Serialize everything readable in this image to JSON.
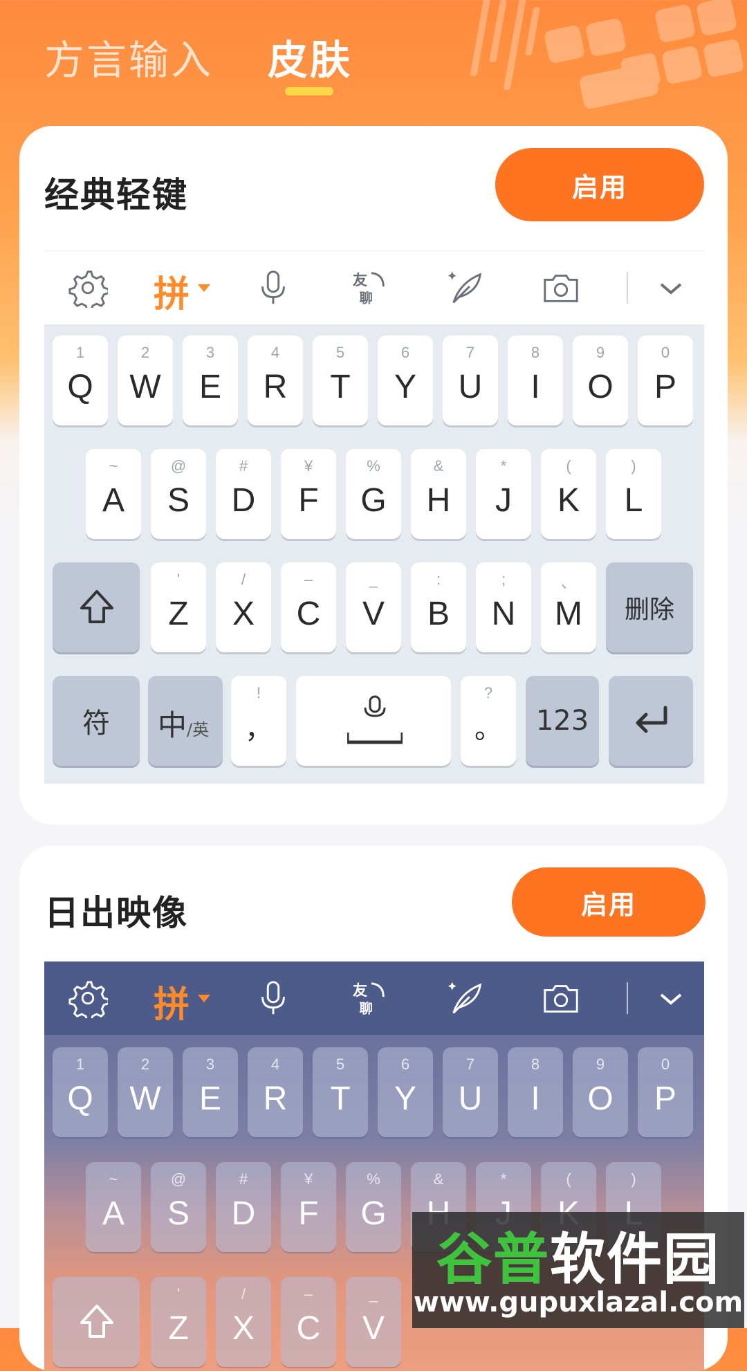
{
  "tabs": [
    {
      "label": "方言输入",
      "active": false
    },
    {
      "label": "皮肤",
      "active": true
    }
  ],
  "skins": [
    {
      "title": "经典轻键",
      "action_label": "启用"
    },
    {
      "title": "日出映像",
      "action_label": "启用"
    }
  ],
  "toolbar": {
    "icons": [
      "gear-icon",
      "pinyin-mode",
      "microphone-icon",
      "youliao-icon",
      "handwriting-quill-icon",
      "camera-icon",
      "chevron-down-icon"
    ],
    "pinyin_label": "拼"
  },
  "keyboard": {
    "row1": [
      {
        "main": "Q",
        "sub": "1"
      },
      {
        "main": "W",
        "sub": "2"
      },
      {
        "main": "E",
        "sub": "3"
      },
      {
        "main": "R",
        "sub": "4"
      },
      {
        "main": "T",
        "sub": "5"
      },
      {
        "main": "Y",
        "sub": "6"
      },
      {
        "main": "U",
        "sub": "7"
      },
      {
        "main": "I",
        "sub": "8"
      },
      {
        "main": "O",
        "sub": "9"
      },
      {
        "main": "P",
        "sub": "0"
      }
    ],
    "row2": [
      {
        "main": "A",
        "sub": "~"
      },
      {
        "main": "S",
        "sub": "@"
      },
      {
        "main": "D",
        "sub": "#"
      },
      {
        "main": "F",
        "sub": "¥"
      },
      {
        "main": "G",
        "sub": "%"
      },
      {
        "main": "H",
        "sub": "&"
      },
      {
        "main": "J",
        "sub": "*"
      },
      {
        "main": "K",
        "sub": "("
      },
      {
        "main": "L",
        "sub": ")"
      }
    ],
    "row3": [
      {
        "main": "Z",
        "sub": "'"
      },
      {
        "main": "X",
        "sub": "/"
      },
      {
        "main": "C",
        "sub": "–"
      },
      {
        "main": "V",
        "sub": "_"
      },
      {
        "main": "B",
        "sub": ":"
      },
      {
        "main": "N",
        "sub": ";"
      },
      {
        "main": "M",
        "sub": "、"
      }
    ],
    "delete_label": "删除",
    "symbol_label": "符",
    "zh_label": "中",
    "en_label": "/英",
    "comma": {
      "main": "，",
      "sub": "!"
    },
    "period": {
      "main": "。",
      "sub": "?"
    },
    "num_label": "123"
  },
  "watermark": {
    "title_green": "谷普",
    "title_white": "软件园",
    "url": "www.gupuxlazal.com"
  },
  "colors": {
    "accent": "#ff7421",
    "pinyin": "#ff8a2a",
    "header_gradient_top": "#ff8a3d"
  }
}
